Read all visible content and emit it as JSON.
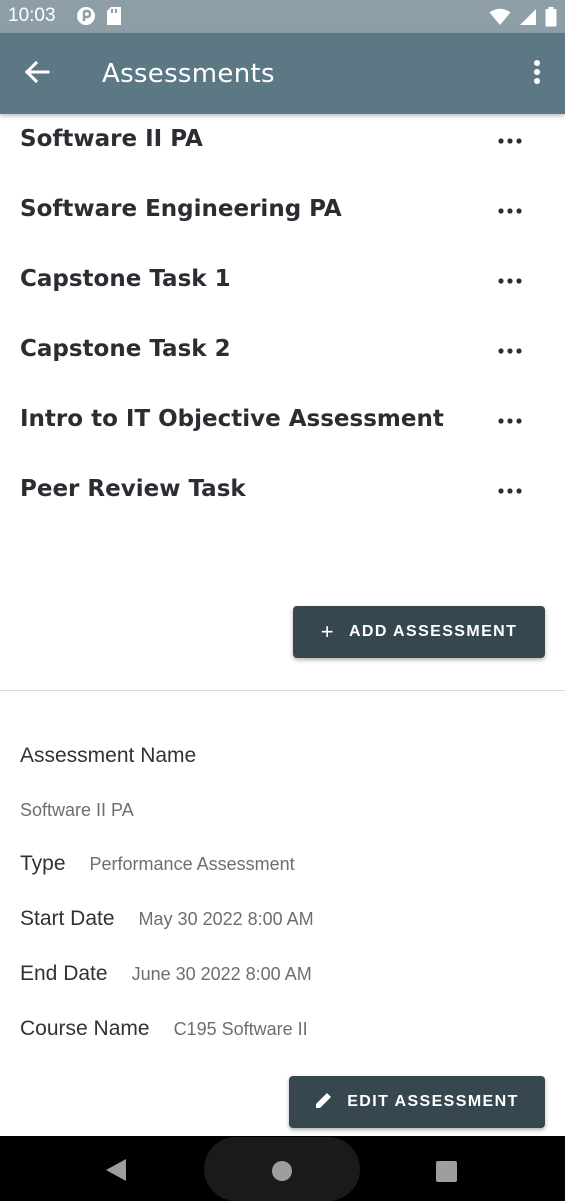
{
  "status_bar": {
    "time": "10:03",
    "icons_left": [
      "data-saver-icon",
      "sd-card-icon"
    ],
    "icons_right": [
      "wifi-icon",
      "signal-icon",
      "battery-icon"
    ]
  },
  "app_bar": {
    "title": "Assessments",
    "back_icon": "arrow-back-icon",
    "menu_icon": "more-vert-icon",
    "background": "#5c7885"
  },
  "assessments": [
    {
      "title": "Software II PA"
    },
    {
      "title": "Software Engineering PA"
    },
    {
      "title": "Capstone Task 1"
    },
    {
      "title": "Capstone Task 2"
    },
    {
      "title": "Intro to IT Objective Assessment"
    },
    {
      "title": "Peer Review Task"
    }
  ],
  "add_button": {
    "label": "ADD ASSESSMENT",
    "icon": "plus-icon"
  },
  "details": {
    "heading": "Assessment Name",
    "name": "Software II PA",
    "type_label": "Type",
    "type_value": "Performance Assessment",
    "start_label": "Start Date",
    "start_value": "May 30 2022 8:00 AM",
    "end_label": "End Date",
    "end_value": "June 30 2022 8:00 AM",
    "course_label": "Course Name",
    "course_value": "C195 Software II"
  },
  "edit_button": {
    "label": "EDIT ASSESSMENT",
    "icon": "pencil-icon"
  },
  "colors": {
    "button": "#37474f",
    "status_bar": "#8e9ea7",
    "nav_bar": "#000000"
  }
}
